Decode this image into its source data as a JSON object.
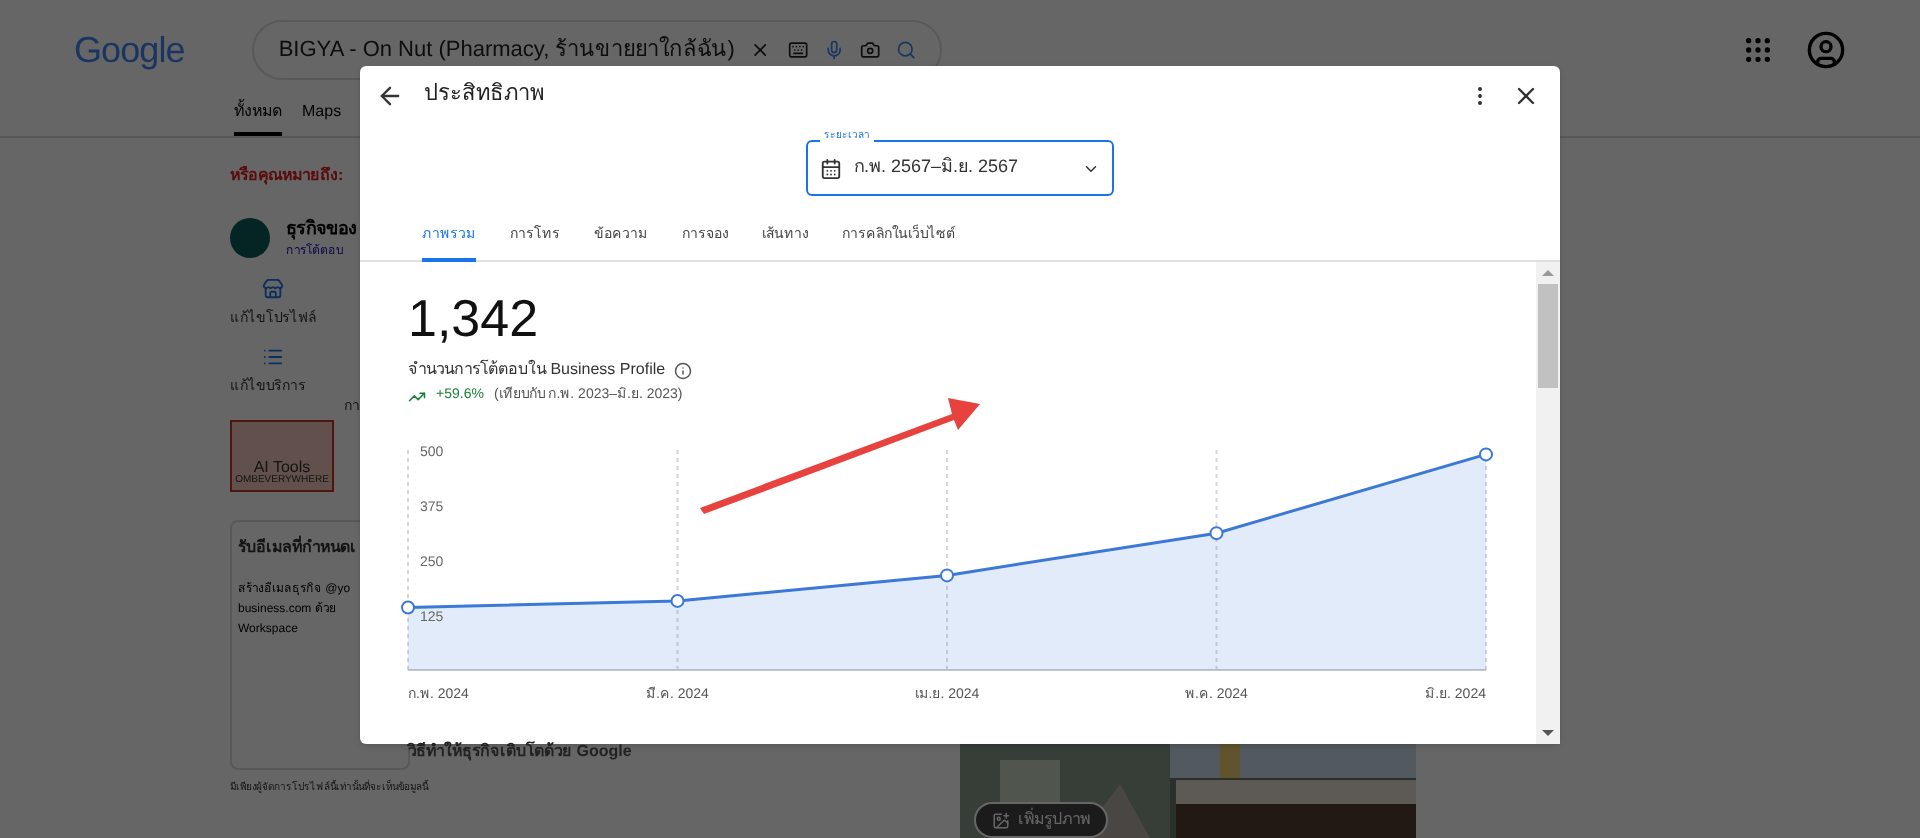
{
  "page": {
    "logo": "Google",
    "search_value": "BIGYA - On Nut (Pharmacy, ร้านขายยาใกล้ฉัน)",
    "tabs": [
      {
        "label": "ทั้งหมด",
        "selected": true
      },
      {
        "label": "Maps",
        "selected": false
      }
    ],
    "did_you_mean": "หรือคุณหมายถึง:",
    "business_title": "ธุรกิจของ",
    "business_sub": "การโต้ตอบ",
    "actions": [
      {
        "label": "แก้ไขโปรไฟล์",
        "kind": "store"
      },
      {
        "label": "แก้ไขบริการ",
        "kind": "list"
      }
    ],
    "action_cut": "กา",
    "ai_tools": {
      "title": "AI Tools",
      "subtitle": "OMBEVERYWHERE"
    },
    "email_card": {
      "title": "รับอีเมลที่กำหนดเ",
      "lines": [
        "สร้างอีเมลธุรกิจ @yo",
        "business.com ด้วย",
        "Workspace"
      ]
    },
    "footer_note": "มีเพียงผู้จัดการโปรไฟล์นี้เท่านั้นที่จะเห็นข้อมูลนี้",
    "add_photo": "เพิ่มรูปภาพ"
  },
  "dialog": {
    "title": "ประสิทธิภาพ",
    "date_range": {
      "label": "ระยะเวลา",
      "value": "ก.พ. 2567–มิ.ย. 2567"
    },
    "tabs": [
      {
        "label": "ภาพรวม",
        "selected": true
      },
      {
        "label": "การโทร",
        "selected": false
      },
      {
        "label": "ข้อความ",
        "selected": false
      },
      {
        "label": "การจอง",
        "selected": false
      },
      {
        "label": "เส้นทาง",
        "selected": false
      },
      {
        "label": "การคลิกในเว็บไซต์",
        "selected": false
      }
    ],
    "total": "1,342",
    "total_label": "จำนวนการโต้ตอบใน Business Profile",
    "change": "+59.6%",
    "comparison": "(เทียบกับ ก.พ. 2023–มิ.ย. 2023)",
    "chart_data": {
      "type": "area",
      "categories": [
        "ก.พ. 2024",
        "มี.ค. 2024",
        "เม.ย. 2024",
        "พ.ค. 2024",
        "มิ.ย. 2024"
      ],
      "series": [
        {
          "color": "#3b78d8",
          "values": [
            142,
            157,
            215,
            311,
            490
          ]
        }
      ],
      "ylim": [
        0,
        500
      ],
      "grid": true,
      "yticks": [
        125,
        250,
        375,
        500
      ]
    },
    "section_heading": "วิธีทำให้ธุรกิจเติบโตด้วย Google"
  }
}
